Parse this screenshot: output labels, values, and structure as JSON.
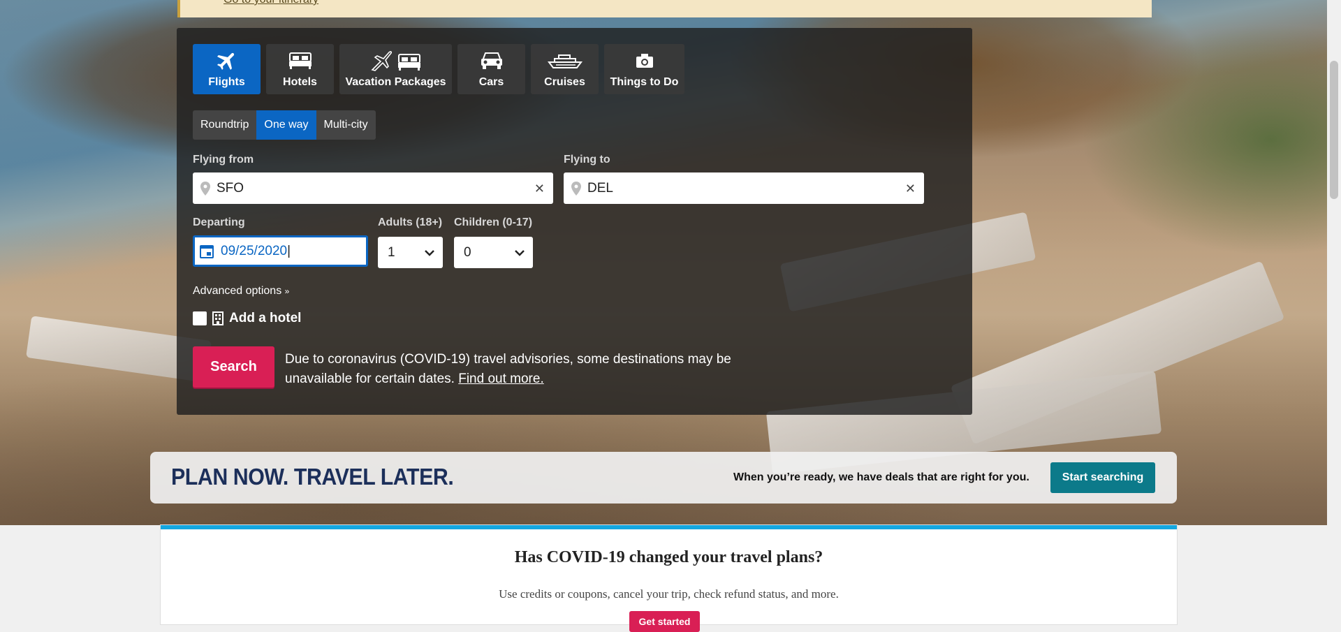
{
  "alert": {
    "link_text": "Go to your itinerary"
  },
  "tabs": [
    {
      "label": "Flights",
      "icon": "plane-icon"
    },
    {
      "label": "Hotels",
      "icon": "bed-icon"
    },
    {
      "label": "Vacation Packages",
      "icon": "plane-bed-icon"
    },
    {
      "label": "Cars",
      "icon": "car-icon"
    },
    {
      "label": "Cruises",
      "icon": "ship-icon"
    },
    {
      "label": "Things to Do",
      "icon": "camera-icon"
    }
  ],
  "trip_type": {
    "options": [
      "Roundtrip",
      "One way",
      "Multi-city"
    ],
    "selected": "One way"
  },
  "flying_from": {
    "label": "Flying from",
    "value": "SFO"
  },
  "flying_to": {
    "label": "Flying to",
    "value": "DEL"
  },
  "departing": {
    "label": "Departing",
    "value": "09/25/2020"
  },
  "adults": {
    "label": "Adults (18+)",
    "value": "1"
  },
  "children": {
    "label": "Children (0-17)",
    "value": "0"
  },
  "advanced_options": "Advanced options",
  "add_hotel": "Add a hotel",
  "search_button": "Search",
  "advisory": {
    "text": "Due to coronavirus (COVID-19) travel advisories, some destinations may be unavailable for certain dates.",
    "link": "Find out more."
  },
  "plan_banner": {
    "title": "PLAN NOW. TRAVEL LATER.",
    "text": "When you’re ready, we have deals that are right for you.",
    "button": "Start searching"
  },
  "covid_card": {
    "title": "Has COVID-19 changed your travel plans?",
    "subtitle": "Use credits or coupons, cancel your trip, check refund status, and more.",
    "button": "Get started"
  },
  "colors": {
    "active_tab": "#0b66c3",
    "search_button": "#d91f55",
    "start_searching": "#0c7a8a",
    "covid_border": "#14a7e0"
  }
}
